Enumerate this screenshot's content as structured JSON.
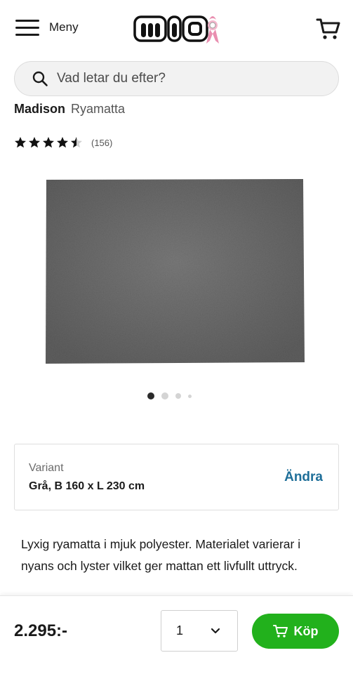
{
  "header": {
    "menu_label": "Meny",
    "logo_text": "MIO",
    "search_placeholder": "Vad letar du efter?"
  },
  "product": {
    "brand": "Madison",
    "subtitle": "Ryamatta",
    "rating": 4.5,
    "rating_max": 5,
    "review_count": "(156)",
    "image_color": "#6b6b6b",
    "carousel": {
      "slides": 4,
      "active": 1
    },
    "variant": {
      "label": "Variant",
      "value": "Grå, B 160 x L 230 cm",
      "change_label": "Ändra"
    },
    "description": "Lyxig ryamatta i mjuk polyester. Materialet varierar i nyans och lyster vilket ger mattan ett livfullt uttryck."
  },
  "purchase": {
    "price": "2.295:-",
    "quantity": "1",
    "buy_label": "Köp",
    "buy_color": "#22b11c"
  },
  "colors": {
    "accent_link": "#1f6f99",
    "text": "#1a1a1a"
  }
}
